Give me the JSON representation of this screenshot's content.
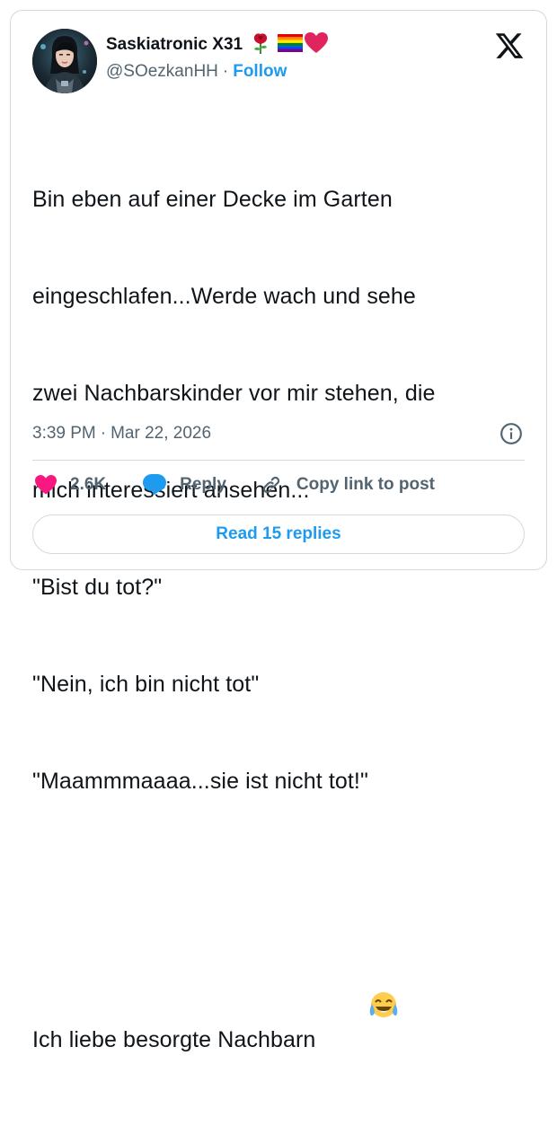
{
  "author": {
    "display_name": "Saskiatronic X31",
    "handle": "@SOezkanHH",
    "separator": "·",
    "follow_label": "Follow",
    "name_emojis": [
      "rose",
      "rainbow-flag",
      "red-heart"
    ]
  },
  "tweet": {
    "lines": [
      "Bin eben auf einer Decke im Garten",
      "eingeschlafen...Werde wach und sehe",
      "zwei Nachbarskinder vor mir stehen, die",
      "mich interessiert ansehen...",
      "\"Bist du tot?\"",
      "\"Nein, ich bin nicht tot\"",
      "\"Maammmaaaa...sie ist nicht tot!\"",
      "",
      "Ich liebe besorgte Nachbarn"
    ],
    "trailing_emoji": "tears-of-joy",
    "time": "3:39 PM",
    "date_separator": "·",
    "date": "Mar 22, 2026"
  },
  "actions": {
    "like_count": "2.6K",
    "reply_label": "Reply",
    "copy_link_label": "Copy link to post"
  },
  "footer": {
    "read_replies_label": "Read 15 replies"
  },
  "colors": {
    "accent": "#1d9bf0",
    "like": "#f91880",
    "text": "#0f1419",
    "secondary": "#536471",
    "border": "#cfd9de"
  }
}
